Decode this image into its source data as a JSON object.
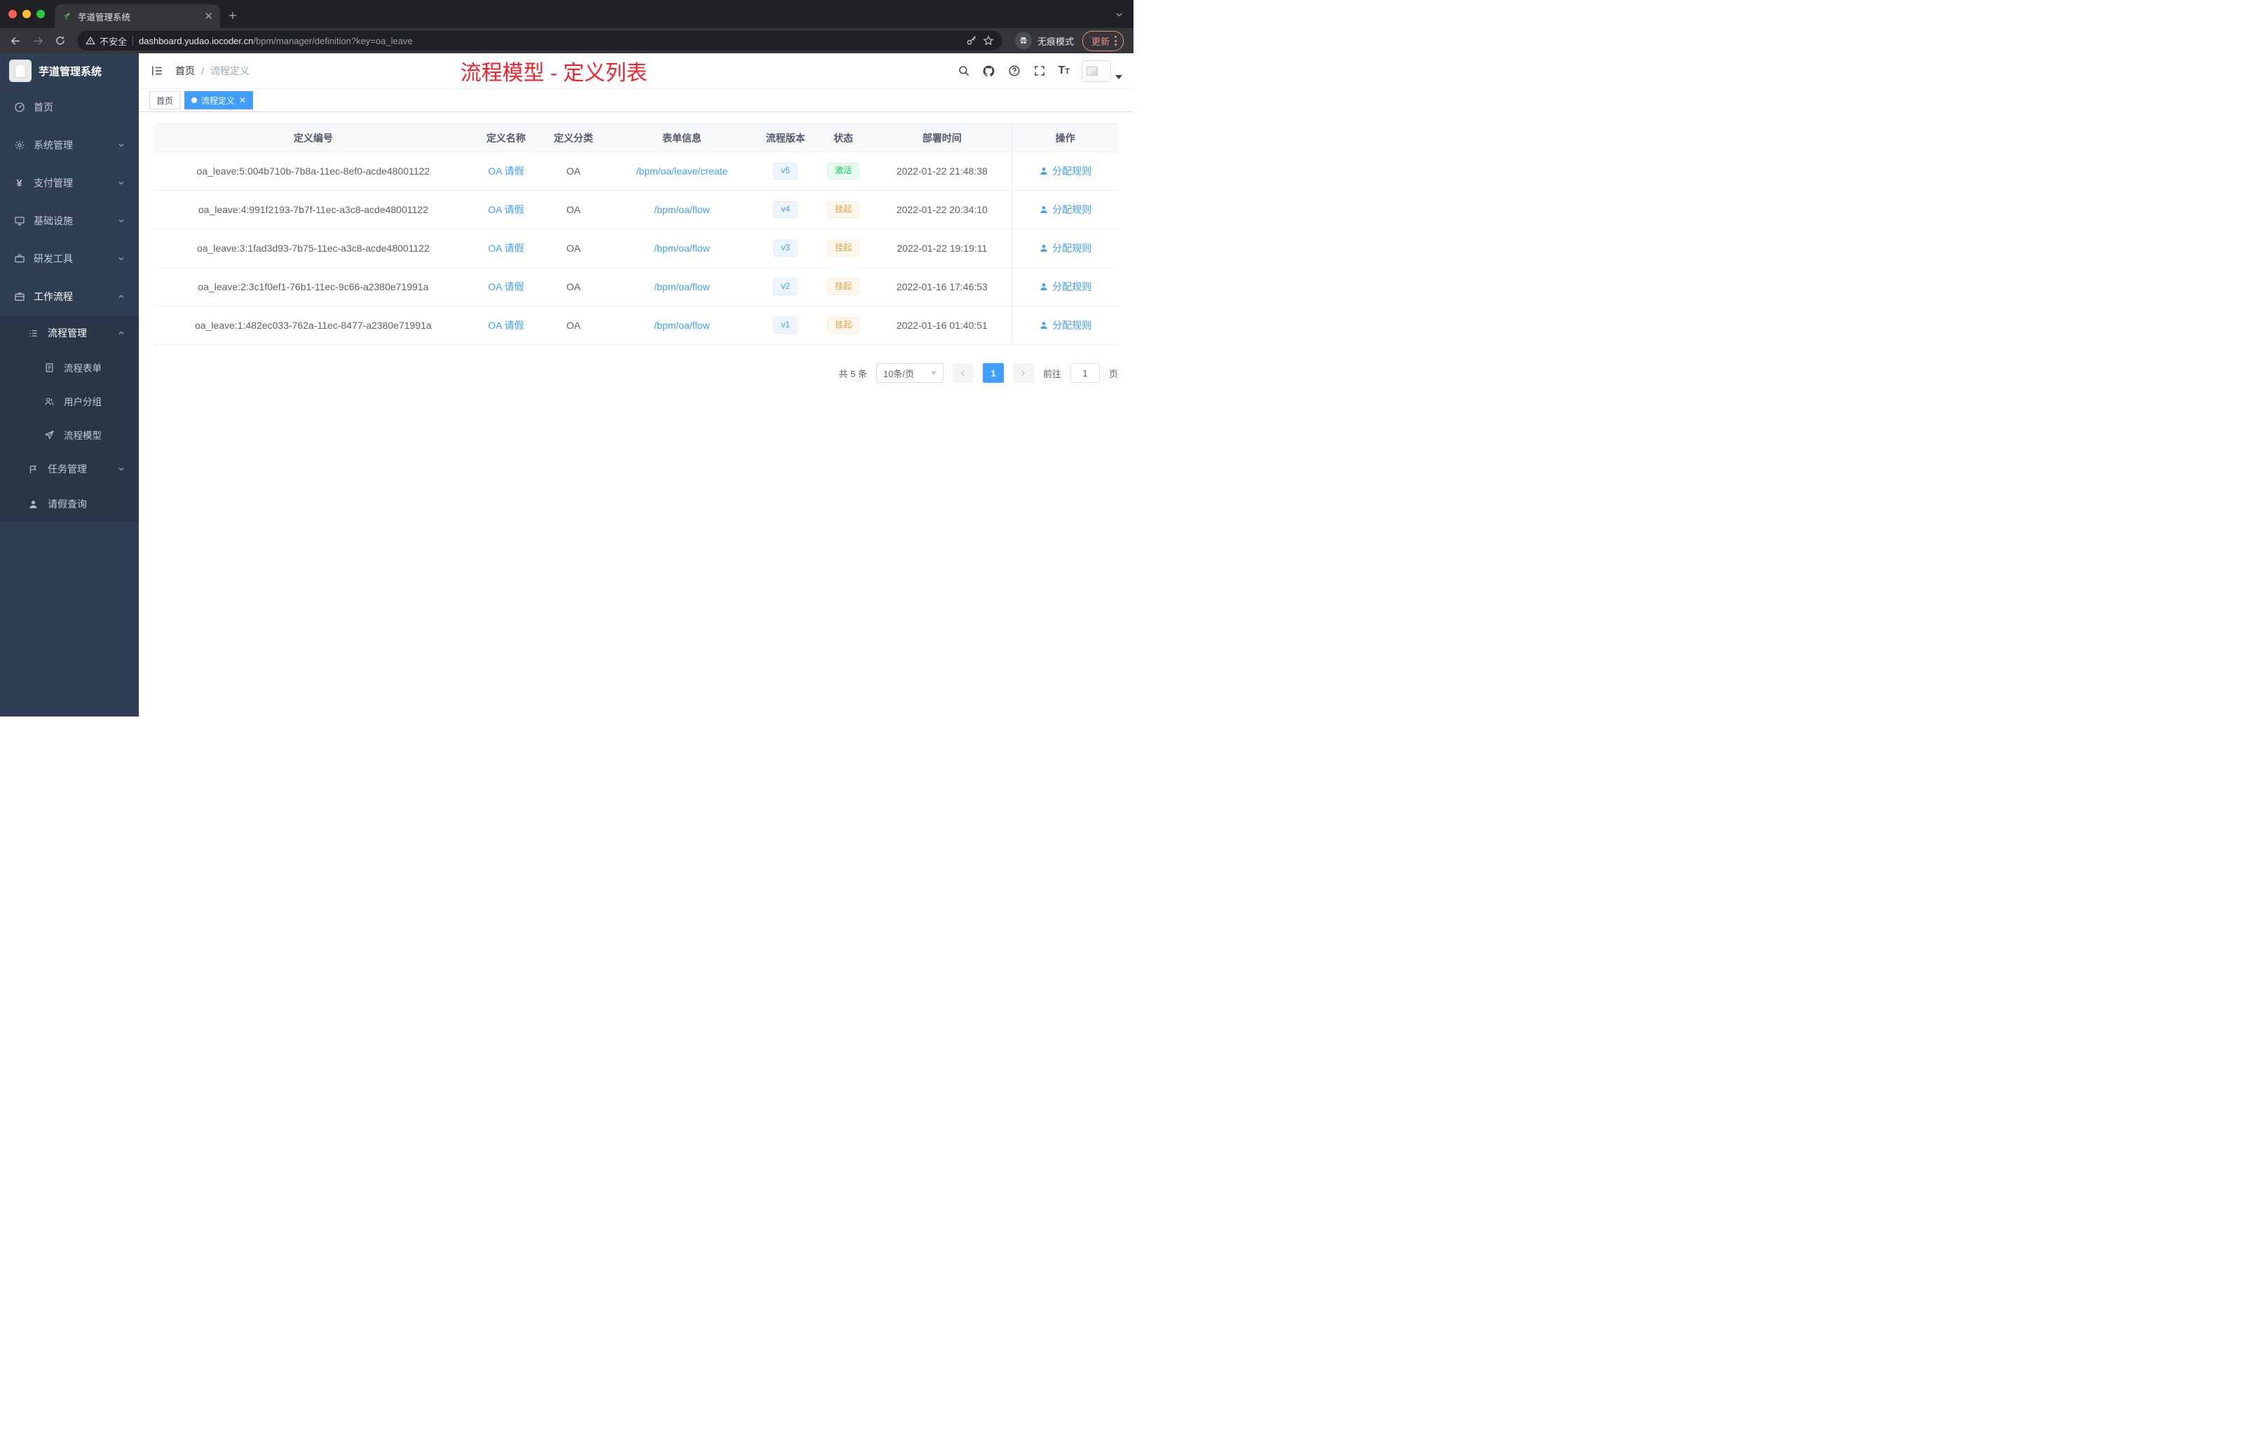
{
  "browser": {
    "tab_title": "芋道管理系统",
    "security_label": "不安全",
    "url_domain": "dashboard.yudao.iocoder.cn",
    "url_path": "/bpm/manager/definition?key=oa_leave",
    "incognito_label": "无痕模式",
    "update_label": "更新"
  },
  "sidebar": {
    "logo_title": "芋道管理系统",
    "items": [
      {
        "label": "首页"
      },
      {
        "label": "系统管理"
      },
      {
        "label": "支付管理"
      },
      {
        "label": "基础设施"
      },
      {
        "label": "研发工具"
      },
      {
        "label": "工作流程"
      },
      {
        "label": "流程管理"
      },
      {
        "label": "流程表单"
      },
      {
        "label": "用户分组"
      },
      {
        "label": "流程模型"
      },
      {
        "label": "任务管理"
      },
      {
        "label": "请假查询"
      }
    ]
  },
  "header": {
    "breadcrumb_home": "首页",
    "breadcrumb_separator": "/",
    "breadcrumb_current": "流程定义",
    "annotation": "流程模型 - 定义列表"
  },
  "tags": {
    "home": "首页",
    "active": "流程定义"
  },
  "table": {
    "columns": [
      "定义编号",
      "定义名称",
      "定义分类",
      "表单信息",
      "流程版本",
      "状态",
      "部署时间",
      "操作"
    ],
    "action_label": "分配规则",
    "rows": [
      {
        "id": "oa_leave:5:004b710b-7b8a-11ec-8ef0-acde48001122",
        "name": "OA 请假",
        "category": "OA",
        "form": "/bpm/oa/leave/create",
        "version": "v5",
        "status": "激活",
        "status_type": "success",
        "time": "2022-01-22 21:48:38"
      },
      {
        "id": "oa_leave:4:991f2193-7b7f-11ec-a3c8-acde48001122",
        "name": "OA 请假",
        "category": "OA",
        "form": "/bpm/oa/flow",
        "version": "v4",
        "status": "挂起",
        "status_type": "warning",
        "time": "2022-01-22 20:34:10"
      },
      {
        "id": "oa_leave:3:1fad3d93-7b75-11ec-a3c8-acde48001122",
        "name": "OA 请假",
        "category": "OA",
        "form": "/bpm/oa/flow",
        "version": "v3",
        "status": "挂起",
        "status_type": "warning",
        "time": "2022-01-22 19:19:11"
      },
      {
        "id": "oa_leave:2:3c1f0ef1-76b1-11ec-9c66-a2380e71991a",
        "name": "OA 请假",
        "category": "OA",
        "form": "/bpm/oa/flow",
        "version": "v2",
        "status": "挂起",
        "status_type": "warning",
        "time": "2022-01-16 17:46:53"
      },
      {
        "id": "oa_leave:1:482ec033-762a-11ec-8477-a2380e71991a",
        "name": "OA 请假",
        "category": "OA",
        "form": "/bpm/oa/flow",
        "version": "v1",
        "status": "挂起",
        "status_type": "warning",
        "time": "2022-01-16 01:40:51"
      }
    ]
  },
  "pagination": {
    "total": "共 5 条",
    "page_size": "10条/页",
    "current_page": "1",
    "goto": "前往",
    "goto_value": "1",
    "page_unit": "页"
  },
  "colors": {
    "accent_blue": "#409eff",
    "annotation_red": "#f5222d",
    "success_green": "#13ce66",
    "warning_orange": "#e6a23c",
    "sidebar_bg": "#2f3e52"
  }
}
